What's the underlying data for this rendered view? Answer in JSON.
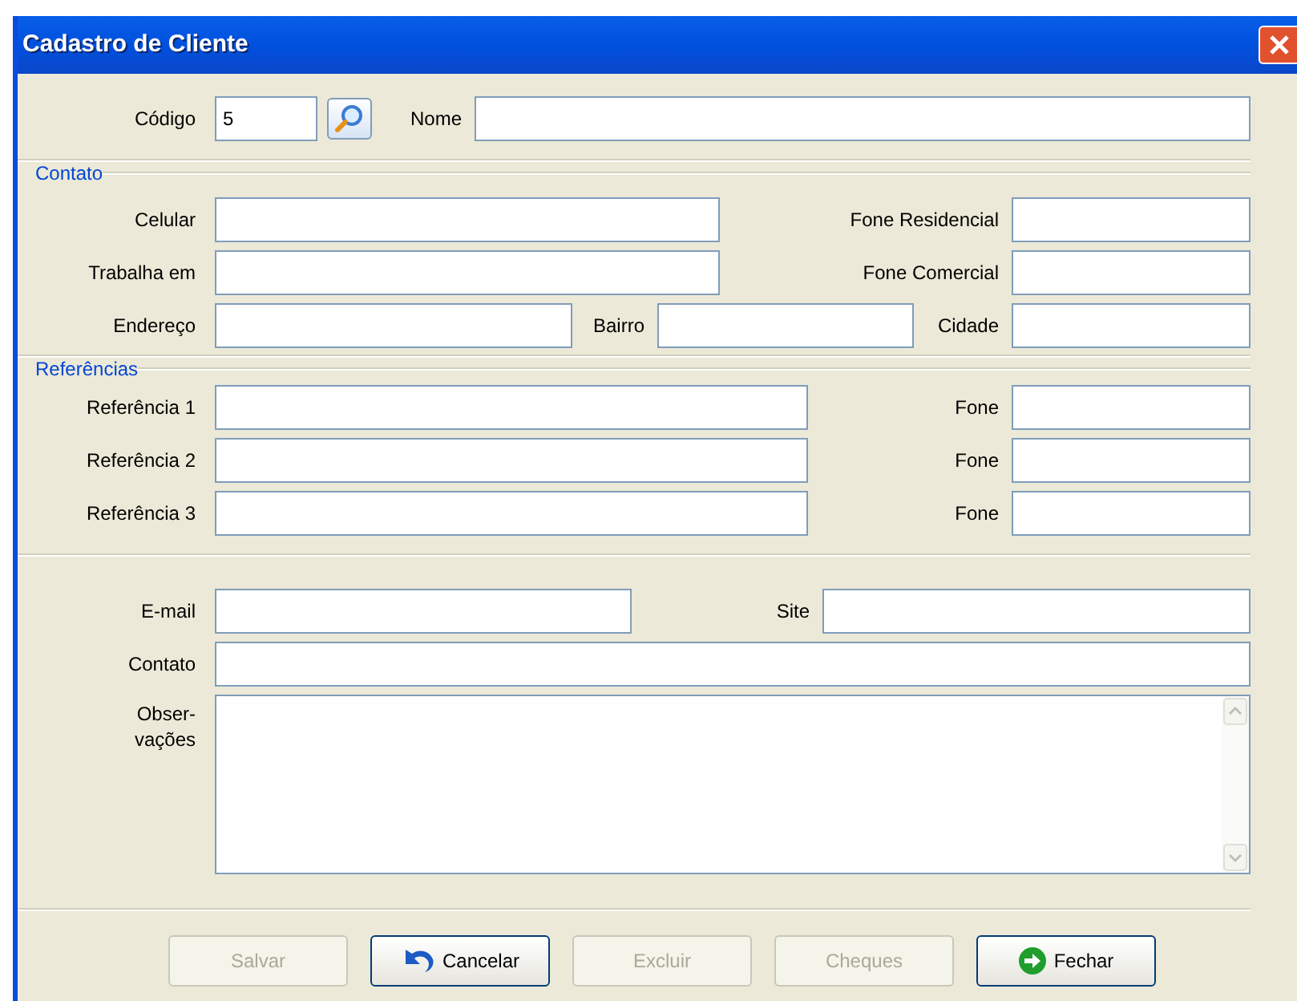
{
  "window": {
    "title": "Cadastro de Cliente"
  },
  "header": {
    "code": {
      "label": "Código",
      "value": "5"
    },
    "name": {
      "label": "Nome"
    }
  },
  "contato": {
    "legend": "Contato",
    "celular": "Celular",
    "fone_residencial": "Fone Residencial",
    "trabalha_em": "Trabalha em",
    "fone_comercial": "Fone Comercial",
    "endereco": "Endereço",
    "bairro": "Bairro",
    "cidade": "Cidade"
  },
  "referencias": {
    "legend": "Referências",
    "rows": [
      {
        "label": "Referência 1",
        "phone_label": "Fone"
      },
      {
        "label": "Referência 2",
        "phone_label": "Fone"
      },
      {
        "label": "Referência 3",
        "phone_label": "Fone"
      }
    ]
  },
  "extra": {
    "email": "E-mail",
    "site": "Site",
    "contato": "Contato",
    "observacoes": [
      "Obser-",
      "vações"
    ]
  },
  "buttons": [
    {
      "label": "Salvar",
      "disabled": true,
      "kind": "plain"
    },
    {
      "label": "Cancelar",
      "disabled": false,
      "kind": "undo"
    },
    {
      "label": "Excluir",
      "disabled": true,
      "kind": "plain"
    },
    {
      "label": "Cheques",
      "disabled": true,
      "kind": "plain"
    },
    {
      "label": "Fechar",
      "disabled": false,
      "kind": "close"
    }
  ]
}
